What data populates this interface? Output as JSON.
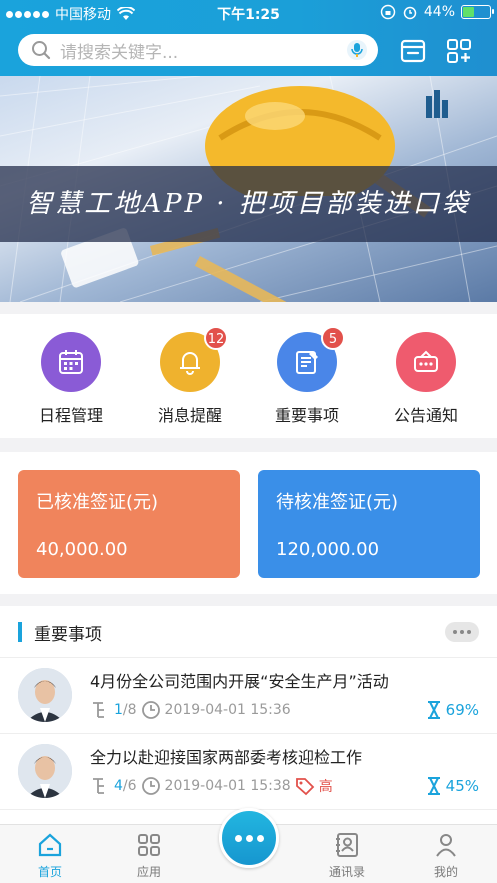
{
  "status": {
    "carrier": "中国移动",
    "time": "下午1:25",
    "battery": "44%"
  },
  "search": {
    "placeholder": "请搜索关键字..."
  },
  "banner": {
    "slogan": "智慧工地APP · 把项目部装进口袋"
  },
  "quick_menu": [
    {
      "label": "日程管理",
      "icon": "calendar-icon",
      "color": "#8a5bd6",
      "badge": null
    },
    {
      "label": "消息提醒",
      "icon": "bell-icon",
      "color": "#efb22e",
      "badge": "12"
    },
    {
      "label": "重要事项",
      "icon": "document-icon",
      "color": "#4a86e8",
      "badge": "5"
    },
    {
      "label": "公告通知",
      "icon": "announcement-icon",
      "color": "#ef5b6e",
      "badge": null
    }
  ],
  "stats": {
    "approved": {
      "title": "已核准签证(元)",
      "value": "40,000.00",
      "color": "#f0845c"
    },
    "pending": {
      "title": "待核准签证(元)",
      "value": "120,000.00",
      "color": "#3a8fe8"
    }
  },
  "important": {
    "title": "重要事项",
    "items": [
      {
        "title": "4月份全公司范围内开展“安全生产月”活动",
        "done": "1",
        "total": "/8",
        "time": "2019-04-01 15:36",
        "priority": "",
        "percent": "69%"
      },
      {
        "title": "全力以赴迎接国家两部委考核迎检工作",
        "done": "4",
        "total": "/6",
        "time": "2019-04-01 15:38",
        "priority": "高",
        "percent": "45%"
      }
    ]
  },
  "tabbar": [
    {
      "label": "首页",
      "icon": "home-icon",
      "active": true
    },
    {
      "label": "应用",
      "icon": "apps-icon",
      "active": false
    },
    {
      "label": "",
      "icon": "more-icon",
      "active": false
    },
    {
      "label": "通讯录",
      "icon": "contacts-icon",
      "active": false
    },
    {
      "label": "我的",
      "icon": "profile-icon",
      "active": false
    }
  ],
  "colors": {
    "accent": "#1aa3dc",
    "danger": "#e2514b"
  }
}
